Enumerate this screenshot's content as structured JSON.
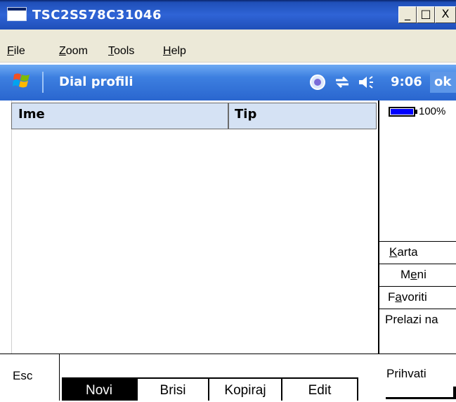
{
  "window": {
    "title": "TSC2SS78C31046",
    "buttons": {
      "minimize": "_",
      "maximize": "□",
      "close": "X"
    }
  },
  "menu": {
    "items": [
      {
        "label": "File"
      },
      {
        "label": "Zoom"
      },
      {
        "label": "Tools"
      },
      {
        "label": "Help"
      }
    ]
  },
  "wm_bar": {
    "title": "Dial profili",
    "time": "9:06",
    "ok": "ok",
    "icons": [
      "connectivity-icon",
      "sync-icon",
      "volume-icon"
    ]
  },
  "list": {
    "columns": [
      {
        "label": "Ime"
      },
      {
        "label": "Tip"
      }
    ],
    "rows": []
  },
  "side_panel": {
    "battery_text": "100%",
    "battery_level": 1.0,
    "buttons": [
      {
        "label": "Karta",
        "underline": "K"
      },
      {
        "label": "Meni",
        "underline": "e"
      },
      {
        "label": "Favoriti",
        "underline": "a"
      },
      {
        "label": "Prelazi na"
      }
    ]
  },
  "bottom": {
    "esc": "Esc",
    "tabs": [
      {
        "label": "Novi",
        "active": true
      },
      {
        "label": "Brisi"
      },
      {
        "label": "Kopiraj"
      },
      {
        "label": "Edit"
      }
    ],
    "accept": "Prihvati"
  },
  "colors": {
    "title_bar": "#2f64d6",
    "wm_bar": "#3d7fe0",
    "header_fill": "#d5e2f4",
    "battery_fill": "#0000ff"
  }
}
